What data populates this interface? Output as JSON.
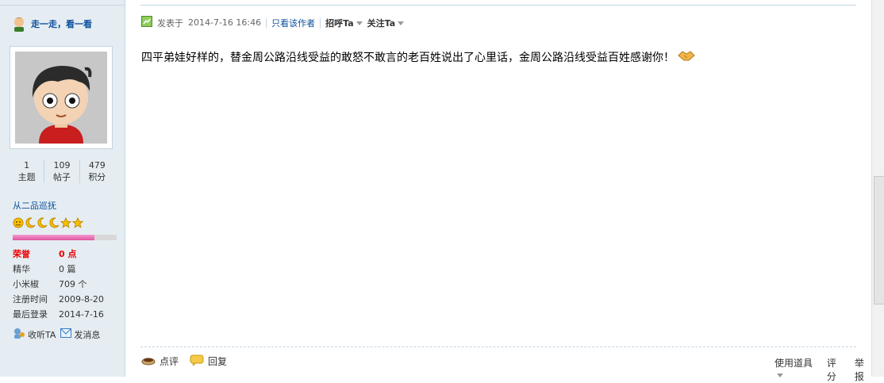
{
  "sidebar": {
    "author_name": "走一走，看一看",
    "stats": [
      {
        "value": "1",
        "label": "主题"
      },
      {
        "value": "109",
        "label": "帖子"
      },
      {
        "value": "479",
        "label": "积分"
      }
    ],
    "rank": "从二品巡抚",
    "level_progress": 0.79,
    "info": [
      {
        "key": "荣誉",
        "value": "0 点",
        "highlight": true
      },
      {
        "key": "精华",
        "value": "0 篇"
      },
      {
        "key": "小米椒",
        "value": "709 个"
      },
      {
        "key": "注册时间",
        "value": "2009-8-20"
      },
      {
        "key": "最后登录",
        "value": "2014-7-16"
      }
    ],
    "follow_label": "收听TA",
    "message_label": "发消息"
  },
  "post": {
    "posted_prefix": "发表于",
    "posted_time": "2014-7-16 16:46",
    "only_author": "只看该作者",
    "greet": "招呼Ta",
    "follow": "关注Ta",
    "content": "四平弟娃好样的，替金周公路沿线受益的敢怒不敢言的老百姓说出了心里话，金周公路沿线受益百姓感谢你！"
  },
  "actions": {
    "comment": "点评",
    "reply": "回复",
    "use_tool": "使用道具",
    "rate": "评分",
    "report": "举报"
  }
}
